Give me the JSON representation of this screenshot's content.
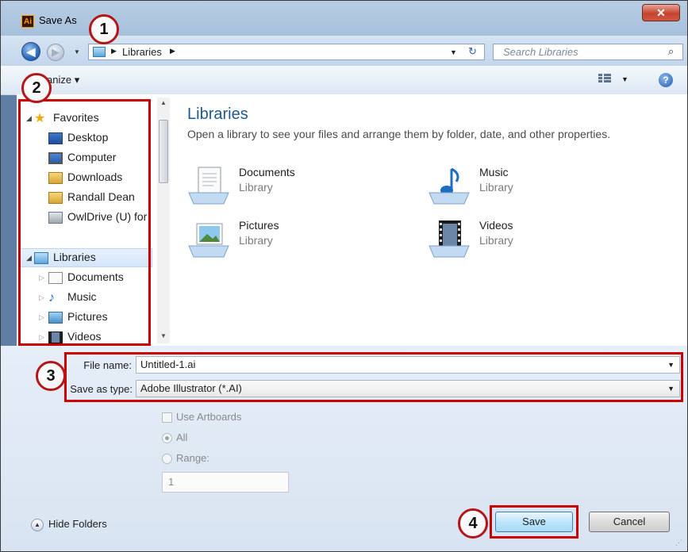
{
  "window": {
    "app_icon_text": "Ai",
    "title": "Save As",
    "close_glyph": "✕"
  },
  "nav": {
    "back_glyph": "◀",
    "forward_glyph": "▶",
    "address": {
      "crumb": "Libraries",
      "arrow": "▸"
    },
    "search_placeholder": "Search Libraries"
  },
  "toolbar": {
    "organize_label": "anize ▾",
    "help_glyph": "?"
  },
  "sidebar": {
    "favorites_label": "Favorites",
    "favorites_items": [
      {
        "label": "Desktop",
        "icon": "desktop-icon"
      },
      {
        "label": "Computer",
        "icon": "computer-icon"
      },
      {
        "label": "Downloads",
        "icon": "downloads-icon"
      },
      {
        "label": "Randall Dean",
        "icon": "user-folder-icon"
      },
      {
        "label": "OwlDrive (U) for",
        "icon": "network-drive-icon"
      }
    ],
    "libraries_label": "Libraries",
    "libraries_items": [
      {
        "label": "Documents",
        "icon": "documents-icon"
      },
      {
        "label": "Music",
        "icon": "music-icon"
      },
      {
        "label": "Pictures",
        "icon": "pictures-icon"
      },
      {
        "label": "Videos",
        "icon": "videos-icon"
      }
    ]
  },
  "main": {
    "title": "Libraries",
    "subtitle": "Open a library to see your files and arrange them by folder, date, and other properties.",
    "libraries": [
      {
        "name": "Documents",
        "type": "Library",
        "icon": "documents-library-icon"
      },
      {
        "name": "Music",
        "type": "Library",
        "icon": "music-library-icon"
      },
      {
        "name": "Pictures",
        "type": "Library",
        "icon": "pictures-library-icon"
      },
      {
        "name": "Videos",
        "type": "Library",
        "icon": "videos-library-icon"
      }
    ]
  },
  "form": {
    "file_name_label": "File name:",
    "file_name_value": "Untitled-1.ai",
    "save_type_label": "Save as type:",
    "save_type_value": "Adobe Illustrator (*.AI)",
    "use_artboards_label": "Use Artboards",
    "all_label": "All",
    "range_label": "Range:",
    "range_value": "1"
  },
  "footer": {
    "hide_folders_label": "Hide Folders",
    "save_label": "Save",
    "cancel_label": "Cancel"
  },
  "callouts": [
    "1",
    "2",
    "3",
    "4"
  ],
  "colors": {
    "callout_red": "#cc0000",
    "title_blue": "#1e5a91"
  }
}
